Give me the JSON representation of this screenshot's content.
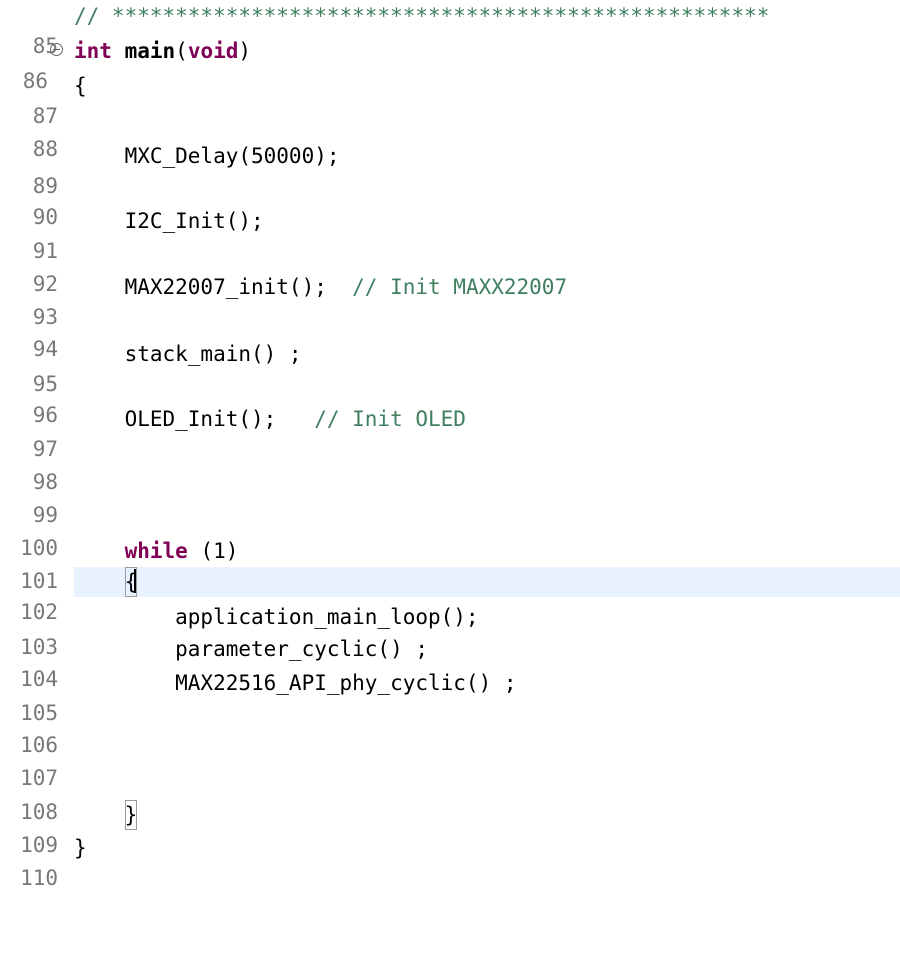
{
  "editor": {
    "language": "C",
    "current_line": 102,
    "colors": {
      "keyword": "#7f0055",
      "comment": "#3f7f5f",
      "line_number": "#787878",
      "current_line_bg": "#e8f2fe"
    },
    "lines": [
      {
        "num": "85",
        "code": "// ****************************************************"
      },
      {
        "num": "86",
        "kw": "int",
        "fn": "main",
        "open": "(",
        "kw2": "void",
        "close": ")",
        "fold_icon": "collapse-icon"
      },
      {
        "num": "87",
        "code": "{"
      },
      {
        "num": "88",
        "code": ""
      },
      {
        "num": "89",
        "code": "    MXC_Delay(50000);"
      },
      {
        "num": "90",
        "code": ""
      },
      {
        "num": "91",
        "code": "    I2C_Init();"
      },
      {
        "num": "92",
        "code": ""
      },
      {
        "num": "93",
        "code": "    MAX22007_init();  ",
        "comment": "// Init MAXX22007"
      },
      {
        "num": "94",
        "code": ""
      },
      {
        "num": "95",
        "code": "    stack_main() ;"
      },
      {
        "num": "96",
        "code": ""
      },
      {
        "num": "97",
        "code": "    OLED_Init();   ",
        "comment": "// Init OLED"
      },
      {
        "num": "98",
        "code": ""
      },
      {
        "num": "99",
        "code": ""
      },
      {
        "num": "100",
        "code": ""
      },
      {
        "num": "101",
        "kw": "while",
        "code": " (1)"
      },
      {
        "num": "102",
        "code": "{"
      },
      {
        "num": "103",
        "code": "        application_main_loop();"
      },
      {
        "num": "104",
        "code": "        parameter_cyclic() ;"
      },
      {
        "num": "105",
        "code": "        MAX22516_API_phy_cyclic() ;"
      },
      {
        "num": "106",
        "code": ""
      },
      {
        "num": "107",
        "code": ""
      },
      {
        "num": "108",
        "code": ""
      },
      {
        "num": "109",
        "code": "}"
      },
      {
        "num": "110",
        "code": "}"
      }
    ]
  }
}
